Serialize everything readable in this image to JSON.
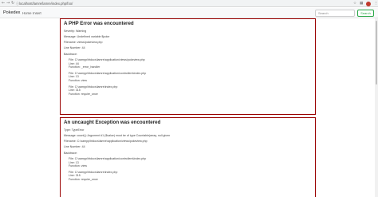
{
  "browser": {
    "url": "localhost/lamre/lamre/index.php/foo/",
    "icons": [
      "back-icon",
      "forward-icon",
      "reload-icon",
      "info-icon",
      "star-icon",
      "extensions-icon",
      "profile-avatar"
    ]
  },
  "navbar": {
    "brand": "Pokedex",
    "links": [
      "Home",
      "Insert"
    ],
    "search_placeholder": "Search",
    "search_button": "Search"
  },
  "error1": {
    "title": "A PHP Error was encountered",
    "severity": "Severity: Warning",
    "message": "Message: Undefined variable $poke",
    "filename": "Filename: views/pokeview.php",
    "line": "Line Number: 44",
    "backtrace": "Backtrace:",
    "frames": [
      {
        "file": "File: C:\\xampp\\htdocs\\lamre\\application\\views\\pokeview.php",
        "line": "Line: 44",
        "function": "Function: _error_handler"
      },
      {
        "file": "File: C:\\xampp\\htdocs\\lamre\\application\\controllers\\Index.php",
        "line": "Line: 13",
        "function": "Function: view"
      },
      {
        "file": "File: C:\\xampp\\htdocs\\lamre\\index.php",
        "line": "Line: 315",
        "function": "Function: require_once"
      }
    ]
  },
  "error2": {
    "title": "An uncaught Exception was encountered",
    "type": "Type: TypeError",
    "message": "Message: count(): Argument #1 ($value) must be of type Countable|array, null given",
    "filename": "Filename: C:\\xampp\\htdocs\\lamre\\application\\views\\pokeview.php",
    "line": "Line Number: 44",
    "backtrace": "Backtrace:",
    "frames": [
      {
        "file": "File: C:\\xampp\\htdocs\\lamre\\application\\controllers\\Index.php",
        "line": "Line: 13",
        "function": "Function: view"
      },
      {
        "file": "File: C:\\xampp\\htdocs\\lamre\\index.php",
        "line": "Line: 315",
        "function": "Function: require_once"
      }
    ]
  },
  "colors": {
    "error_border": "#990000",
    "search_green": "#28a745"
  }
}
